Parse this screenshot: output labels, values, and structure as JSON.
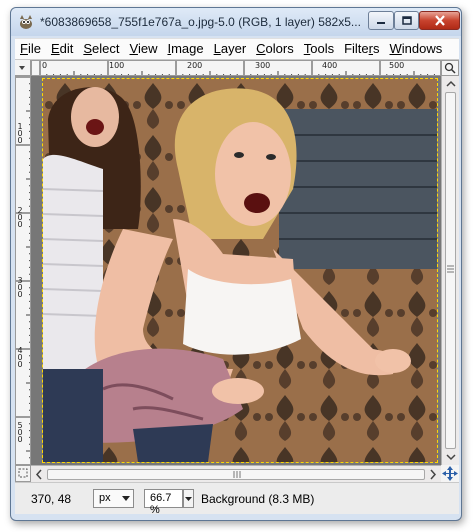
{
  "window": {
    "title": "*6083869658_755f1e767a_o.jpg-5.0 (RGB, 1 layer) 582x5..."
  },
  "menubar": {
    "items": [
      {
        "acc": "F",
        "rest": "ile"
      },
      {
        "acc": "E",
        "rest": "dit"
      },
      {
        "acc": "S",
        "rest": "elect"
      },
      {
        "acc": "V",
        "rest": "iew"
      },
      {
        "acc": "I",
        "rest": "mage"
      },
      {
        "acc": "L",
        "rest": "ayer"
      },
      {
        "acc": "C",
        "rest": "olors"
      },
      {
        "acc": "T",
        "rest": "ools"
      },
      {
        "acc": "",
        "rest": "Filte",
        "acc2": "r",
        "rest2": "s"
      },
      {
        "acc": "W",
        "rest": "indows"
      }
    ]
  },
  "rulers": {
    "horizontal": [
      "0",
      "100",
      "200",
      "300",
      "400",
      "500"
    ],
    "vertical": [
      "100",
      "200",
      "300",
      "400",
      "500"
    ]
  },
  "statusbar": {
    "coordinates": "370, 48",
    "unit": "px",
    "zoom": "66.7 %",
    "layer_info": "Background (8.3 MB)"
  },
  "icons": {
    "app": "gimp-wilber-icon",
    "minimize": "minimize-icon",
    "maximize": "maximize-icon",
    "close": "close-icon",
    "quickmask": "quick-mask-icon",
    "navigate": "navigate-icon",
    "zoom_fit": "zoom-to-fit-icon"
  },
  "colors": {
    "selection_outline": "#ffd800",
    "close_button": "#c8432e",
    "titlebar": "#d6e2f1"
  }
}
